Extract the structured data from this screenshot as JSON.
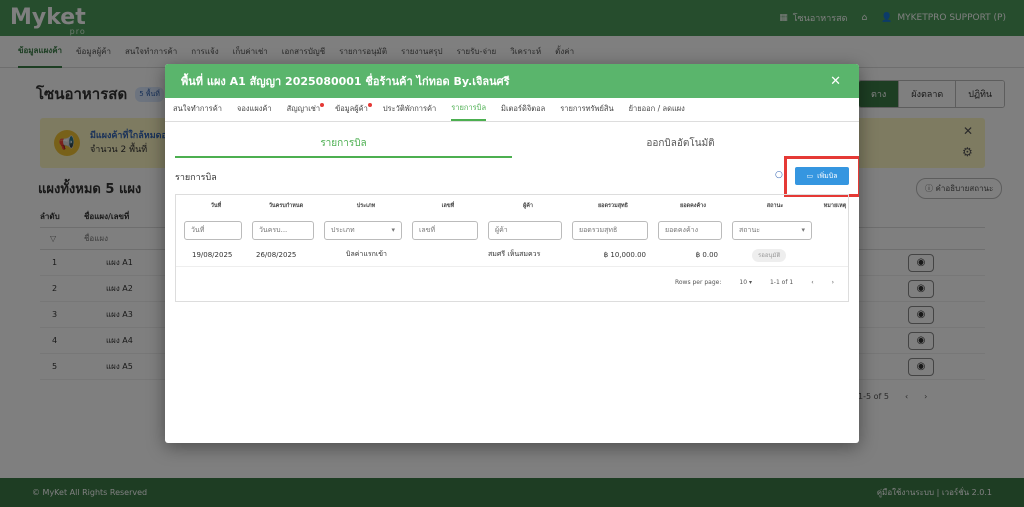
{
  "topbar": {
    "logo": "Myket",
    "logo_sub": "pro",
    "store_name": "โซนอาหารสด",
    "user": "MYKETPRO SUPPORT (P)"
  },
  "mainnav": {
    "items": [
      "ข้อมูลแผงค้า",
      "ข้อมูลผู้ค้า",
      "สนใจทำการค้า",
      "การแจ้ง",
      "เก็บค่าเช่า",
      "เอกสารบัญชี",
      "รายการอนุมัติ",
      "รายงานสรุป",
      "รายรับ-จ่าย",
      "วิเคราะห์",
      "ตั้งค่า"
    ]
  },
  "page": {
    "title": "โซนอาหารสด",
    "badge": "5 พื้นที่",
    "view_tabs": [
      "ตาง",
      "ผังตลาด",
      "ปฏิทิน"
    ],
    "alert_title": "มีแผงค้าที่ใกล้หมดอ",
    "alert_count": "จำนวน 2 พื้นที่",
    "count_title": "แผงทั้งหมด 5 แผง",
    "status_desc_btn": "คำอธิบายสถานะ",
    "table_headers": [
      "ลำดับ",
      "ชื่อแผง/เลขที่"
    ],
    "filter_placeholder": "ชื่อแผง",
    "rows": [
      {
        "idx": "1",
        "name": "แผง A1"
      },
      {
        "idx": "2",
        "name": "แผง A2"
      },
      {
        "idx": "3",
        "name": "แผง A3"
      },
      {
        "idx": "4",
        "name": "แผง A4"
      },
      {
        "idx": "5",
        "name": "แผง A5"
      }
    ],
    "pagination": "1-5 of 5"
  },
  "footer": {
    "copyright": "© MyKet All Rights Reserved",
    "right": "คู่มือใช้งานระบบ | เวอร์ชั่น 2.0.1"
  },
  "modal": {
    "title": "พื้นที่ แผง A1 สัญญา 2025080001 ชื่อร้านค้า ไก่ทอด By.เจิลนศรี",
    "tabs": [
      "สนใจทำการค้า",
      "จองแผงค้า",
      "สัญญาเช่า",
      "ข้อมูลผู้ค้า",
      "ประวัติพักการค้า",
      "รายการบิล",
      "มิเตอร์ดิจิตอล",
      "รายการทรัพย์สิน",
      "ย้ายออก / ลดแผง"
    ],
    "subtabs": [
      "รายการบิล",
      "ออกบิลอัตโนมัติ"
    ],
    "section_title": "รายการบิล",
    "add_bill_label": "เพิ่มบิล",
    "columns": [
      "วันที่",
      "วันครบกำหนด",
      "ประเภท",
      "เลขที่",
      "ผู้ค้า",
      "ยอดรวมสุทธิ",
      "ยอดคงค้าง",
      "สถานะ",
      "หมายเหตุ"
    ],
    "filters": [
      "วันที่",
      "วันครบ...",
      "ประเภท",
      "เลขที่",
      "ผู้ค้า",
      "ยอดรวมสุทธิ",
      "ยอดคงค้าง",
      "สถานะ"
    ],
    "bill": {
      "date": "19/08/2025",
      "due": "26/08/2025",
      "type": "บิลค่าแรกเข้า",
      "number": "",
      "vendor": "สมศรี เห็นสมควร",
      "total": "฿ 10,000.00",
      "outstanding": "฿ 0.00",
      "status": "รออนุมัติ"
    },
    "rows_per_page_label": "Rows per page:",
    "rows_per_page": "10",
    "range": "1-1 of 1"
  }
}
